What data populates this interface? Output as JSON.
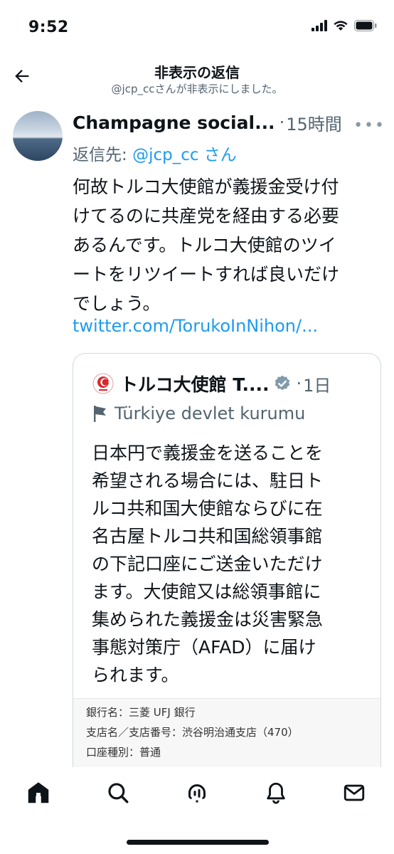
{
  "status_bar": {
    "time": "9:52",
    "icons": [
      "signal-icon",
      "wifi-icon",
      "battery-icon"
    ]
  },
  "header": {
    "title": "非表示の返信",
    "subtitle": "@jcp_ccさんが非表示にしました。"
  },
  "tweet": {
    "author": "Champagne social...",
    "dot": "·",
    "time": "15時間",
    "reply_prefix": "返信先: ",
    "reply_handle": "@jcp_cc さん",
    "body_lines": [
      "何故トルコ大使館が義援金受け付",
      "けてるのに共産党を経由する必要",
      "あるんです。トルコ大使館のツイ",
      "ートをリツイートすれば良いだけ",
      "でしょう。"
    ],
    "link": "twitter.com/TorukoInNihon/..."
  },
  "quote": {
    "name": "トルコ大使館 T....",
    "dot": "·",
    "time": "1日",
    "label": "Türkiye devlet kurumu",
    "body_lines": [
      "日本円で義援金を送ることを",
      "希望される場合には、駐日ト",
      "ルコ共和国大使館ならびに在",
      "名古屋トルコ共和国総領事館",
      "の下記口座にご送金いただけ",
      "ます。大使館又は総領事館に",
      "集められた義援金は災害緊急",
      "事態対策庁（AFAD）に届け",
      "られます。"
    ],
    "image_lines": [
      "銀行名：三菱 UFJ 銀行",
      "支店名／支店番号：渋谷明治通支店（470）",
      "口座種別：普通"
    ]
  },
  "tab_bar": {
    "items": [
      "home-icon",
      "search-icon",
      "spaces-icon",
      "notifications-icon",
      "messages-icon"
    ]
  },
  "colors": {
    "accent": "#1d9bf0",
    "text": "#0f1419",
    "muted": "#536471",
    "border": "#cfd9de"
  }
}
